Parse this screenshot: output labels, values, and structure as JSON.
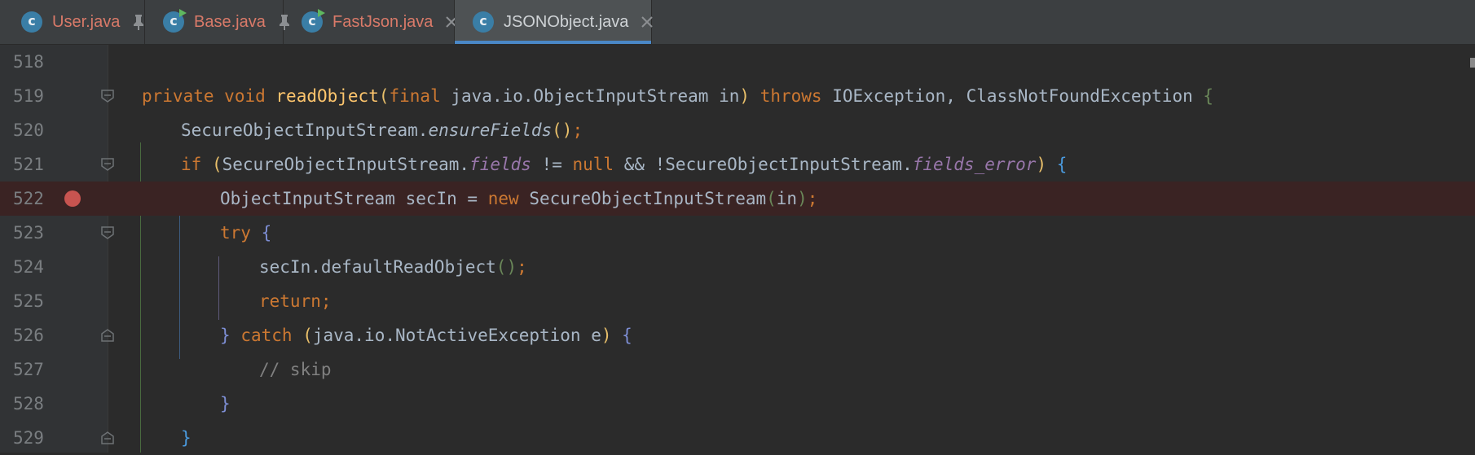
{
  "tabs": [
    {
      "label": "User.java",
      "icon": "java-class-icon",
      "pinned": true,
      "active": false
    },
    {
      "label": "Base.java",
      "icon": "java-runnable-class-icon",
      "pinned": true,
      "active": false
    },
    {
      "label": "FastJson.java",
      "icon": "java-runnable-class-icon",
      "pinned": false,
      "active": false
    },
    {
      "label": "JSONObject.java",
      "icon": "java-class-icon",
      "pinned": false,
      "active": true
    }
  ],
  "line_numbers": [
    "518",
    "519",
    "520",
    "521",
    "522",
    "523",
    "524",
    "525",
    "526",
    "527",
    "528",
    "529"
  ],
  "breakpoint_line": "522",
  "colors": {
    "background": "#2b2b2b",
    "gutter": "#313335",
    "keyword": "#cc7832",
    "method": "#ffc66d",
    "field": "#9876aa",
    "breakpoint": "#c75450",
    "active_tab_underline": "#4a88c7"
  },
  "code": {
    "l519": {
      "t1": "private",
      "t2": "void",
      "t3": "readObject",
      "t4": "(",
      "t5": "final",
      "t6": "java.io.ObjectInputStream in",
      "t7": ")",
      "t8": "throws",
      "t9": "IOException, ClassNotFoundException",
      "t10": "{"
    },
    "l520": {
      "t1": "SecureObjectInputStream.",
      "t2": "ensureFields",
      "t3": "()",
      "t4": ";"
    },
    "l521": {
      "t1": "if",
      "t2": "(",
      "t3": "SecureObjectInputStream.",
      "t4": "fields",
      "t5": " != ",
      "t6": "null",
      "t7": " && !SecureObjectInputStream.",
      "t8": "fields_error",
      "t9": ")",
      "t10": "{"
    },
    "l522": {
      "t1": "ObjectInputStream secIn = ",
      "t2": "new",
      "t3": "SecureObjectInputStream",
      "t4": "(",
      "t5": "in",
      "t6": ")",
      "t7": ";"
    },
    "l523": {
      "t1": "try",
      "t2": "{"
    },
    "l524": {
      "t1": "secIn.defaultReadObject",
      "t2": "()",
      "t3": ";"
    },
    "l525": {
      "t1": "return;"
    },
    "l526": {
      "t1": "}",
      "t2": "catch",
      "t3": "(",
      "t4": "java.io.NotActiveException e",
      "t5": ")",
      "t6": "{"
    },
    "l527": {
      "t1": "// skip"
    },
    "l528": {
      "t1": "}"
    },
    "l529": {
      "t1": "}"
    }
  }
}
